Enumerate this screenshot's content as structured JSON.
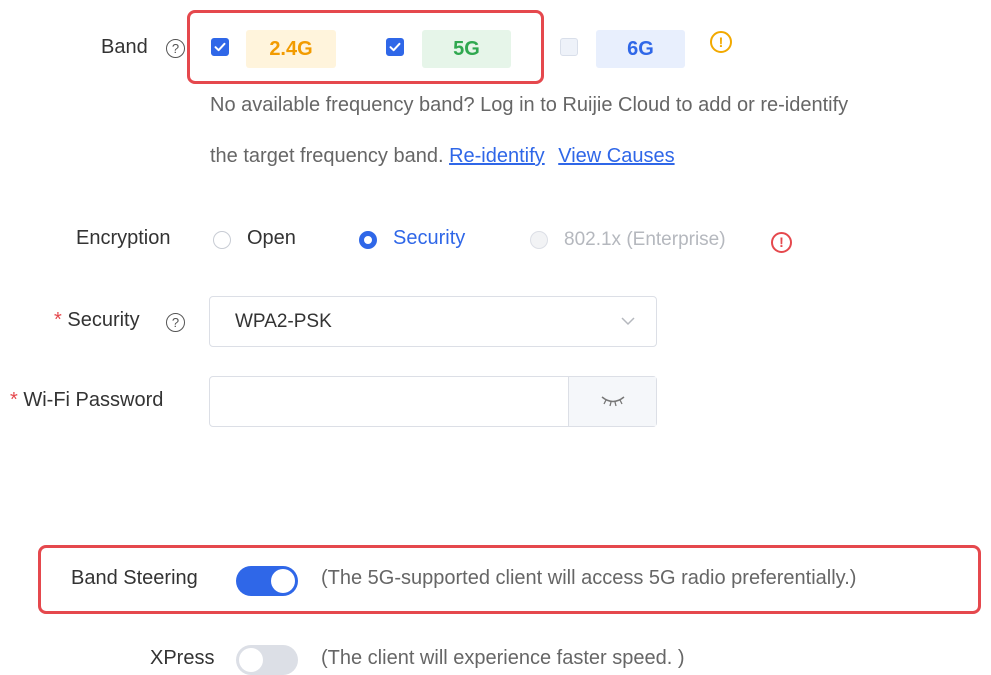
{
  "band": {
    "label": "Band",
    "help": "?",
    "options": [
      {
        "label": "2.4G",
        "checked": true,
        "text_color": "#f29b00",
        "bg_color": "#fff4dc"
      },
      {
        "label": "5G",
        "checked": true,
        "text_color": "#2fa84f",
        "bg_color": "#e6f5e9"
      },
      {
        "label": "6G",
        "checked": false,
        "text_color": "#2f67e8",
        "bg_color": "#e8effd"
      }
    ],
    "warning_icon": "!",
    "hint_line1": "No available frequency band? Log in to Ruijie Cloud to add or re-identify",
    "hint_line2": "the target frequency band.",
    "link_reidentify": "Re-identify",
    "link_view_causes": "View Causes"
  },
  "encryption": {
    "label": "Encryption",
    "options": [
      {
        "label": "Open",
        "state": "unselected"
      },
      {
        "label": "Security",
        "state": "selected"
      },
      {
        "label": "802.1x (Enterprise)",
        "state": "disabled"
      }
    ],
    "error_icon": "!"
  },
  "security": {
    "required_mark": "*",
    "label": "Security",
    "help": "?",
    "value": "WPA2-PSK"
  },
  "wifi_password": {
    "required_mark": "*",
    "label": "Wi-Fi Password",
    "value": "",
    "placeholder": ""
  },
  "band_steering": {
    "label": "Band Steering",
    "enabled": true,
    "description": "(The 5G-supported client will access 5G radio preferentially.)"
  },
  "xpress": {
    "label": "XPress",
    "enabled": false,
    "description": "(The client will experience faster speed. )"
  },
  "colors": {
    "accent": "#2f67e8",
    "highlight": "#e5484d",
    "warning": "#f2a900",
    "required": "#e5484d"
  }
}
